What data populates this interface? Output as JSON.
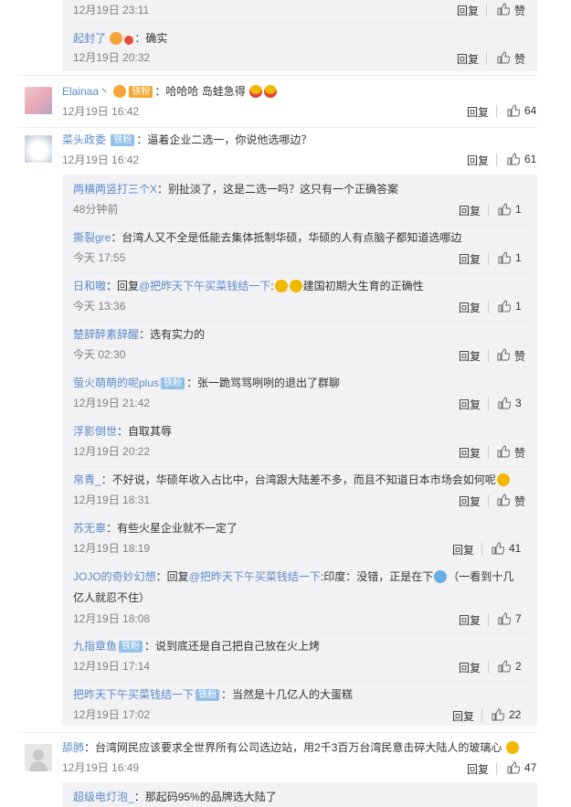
{
  "comments": {
    "top_sub_time": "12月19日 23:11",
    "top_sub_reply": "回复",
    "top_sub_like": "赞",
    "sub1": {
      "name": "起封了",
      "text": "：确实",
      "time": "12月19日 20:32",
      "reply": "回复",
      "like": "赞"
    },
    "c1": {
      "name": "Elainaa丶",
      "badge": "铁粉",
      "text": "：哈哈哈 岛蛙急得",
      "time": "12月19日 16:42",
      "reply": "回复",
      "likes": "64"
    },
    "c2": {
      "name": "菜头政委",
      "badge": "铁粉",
      "text": "：逼着企业二选一，你说他选哪边？",
      "time": "12月19日 16:42",
      "reply": "回复",
      "likes": "61"
    },
    "replies": [
      {
        "name": "两横两竖打三个X",
        "text": "：别扯淡了，这是二选一吗？这只有一个正确答案",
        "time": "48分钟前",
        "reply": "回复",
        "likes": "1"
      },
      {
        "name": "撕裂gre",
        "text": "：台湾人又不全是低能去集体抵制华硕，华硕的人有点脑子都知道选哪边",
        "time": "今天 17:55",
        "reply": "回复",
        "likes": "1"
      },
      {
        "name": "日和嗷",
        "prefix": "：回复",
        "mention": "@把昨天下午买菜钱结一下",
        "text2": "建国初期大生育的正确性",
        "time": "今天 13:36",
        "reply": "回复",
        "likes": "1"
      },
      {
        "name": "楚辞醉素辞醒",
        "text": "：选有实力的",
        "time": "今天 02:30",
        "reply": "回复",
        "likes": "赞"
      },
      {
        "name": "萤火萌萌的呢plus",
        "badge": "铁粉",
        "text": "：张一跪骂骂咧咧的退出了群聊",
        "time": "12月19日 21:42",
        "reply": "回复",
        "likes": "3"
      },
      {
        "name": "浮影倒世",
        "text": "：自取其辱",
        "time": "12月19日 20:22",
        "reply": "回复",
        "likes": "赞"
      },
      {
        "name": "帛青_",
        "text": "：不好说，华硕年收入占比中，台湾跟大陆差不多，而且不知道日本市场会如何呢",
        "time": "12月19日 18:31",
        "reply": "回复",
        "likes": "赞"
      },
      {
        "name": "苏无辜",
        "text": "：有些火星企业就不一定了",
        "time": "12月19日 18:19",
        "reply": "回复",
        "likes": "41"
      },
      {
        "name": "JOJO的奇妙幻想",
        "prefix": "：回复",
        "mention": "@把昨天下午买菜钱结一下",
        "text2": ":印度：没错，正是在下",
        "text3": "（一看到十几",
        "line2": "亿人就忍不住）",
        "time": "12月19日 18:08",
        "reply": "回复",
        "likes": "7"
      },
      {
        "name": "九指章鱼",
        "badge": "铁粉",
        "text": "：说到底还是自己把自己放在火上烤",
        "time": "12月19日 17:14",
        "reply": "回复",
        "likes": "2"
      },
      {
        "name": "把昨天下午买菜钱结一下",
        "badge": "铁粉",
        "text": "：当然是十几亿人的大蛋糕",
        "time": "12月19日 17:02",
        "reply": "回复",
        "likes": "22"
      }
    ],
    "c3": {
      "name": "舔肺",
      "text": "：台湾网民应该要求全世界所有公司选边站，用2千3百万台湾民意击碎大陆人的玻璃心",
      "time": "12月19日 16:49",
      "reply": "回复",
      "likes": "47"
    },
    "c3_sub": {
      "name": "超级电灯泡_",
      "text": "：那起码95%的品牌选大陆了"
    }
  }
}
